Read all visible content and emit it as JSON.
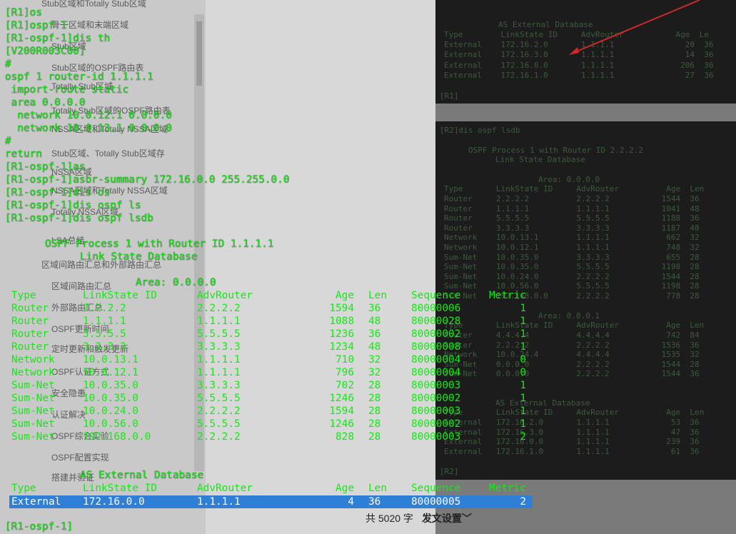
{
  "terminal": {
    "lines": [
      "[R1]os",
      "[R1]ospf 1",
      "[R1-ospf-1]dis th",
      "[V200R003C00]",
      "#",
      "ospf 1 router-id 1.1.1.1",
      " import-route static",
      " area 0.0.0.0",
      "  network 10.0.12.1 0.0.0.0",
      "  network 10.0.13.1 0.0.0.0",
      "#",
      "return",
      "[R1-ospf-1]as",
      "[R1-ospf-1]asbr-summary 172.16.0.0 255.255.0.0",
      "[R1-ospf-1]dis os",
      "[R1-ospf-1]dis ospf ls",
      "[R1-ospf-1]dis ospf lsdb"
    ],
    "process_title": "OSPF Process 1 with Router ID 1.1.1.1",
    "db_title": "Link State Database",
    "area_label": "Area: 0.0.0.0",
    "headers": [
      "Type",
      "LinkState ID",
      "AdvRouter",
      "Age",
      "Len",
      "Sequence",
      "Metric"
    ],
    "rows": [
      [
        "Router",
        "2.2.2.2",
        "2.2.2.2",
        "1594",
        "36",
        "80000006",
        "1"
      ],
      [
        "Router",
        "1.1.1.1",
        "1.1.1.1",
        "1088",
        "48",
        "80000028",
        "1"
      ],
      [
        "Router",
        "5.5.5.5",
        "5.5.5.5",
        "1236",
        "36",
        "80000002",
        "1"
      ],
      [
        "Router",
        "3.3.3.3",
        "3.3.3.3",
        "1234",
        "48",
        "80000008",
        "1"
      ],
      [
        "Network",
        "10.0.13.1",
        "1.1.1.1",
        "710",
        "32",
        "80000004",
        "0"
      ],
      [
        "Network",
        "10.0.12.1",
        "1.1.1.1",
        "796",
        "32",
        "80000004",
        "0"
      ],
      [
        "Sum-Net",
        "10.0.35.0",
        "3.3.3.3",
        "702",
        "28",
        "80000003",
        "1"
      ],
      [
        "Sum-Net",
        "10.0.35.0",
        "5.5.5.5",
        "1246",
        "28",
        "80000002",
        "1"
      ],
      [
        "Sum-Net",
        "10.0.24.0",
        "2.2.2.2",
        "1594",
        "28",
        "80000003",
        "1"
      ],
      [
        "Sum-Net",
        "10.0.56.0",
        "5.5.5.5",
        "1246",
        "28",
        "80000002",
        "1"
      ],
      [
        "Sum-Net",
        "192.168.0.0",
        "2.2.2.2",
        "828",
        "28",
        "80000003",
        "2"
      ]
    ],
    "ext_title": "AS External Database",
    "ext_row": [
      "External",
      "172.16.0.0",
      "1.1.1.1",
      "4",
      "36",
      "80000005",
      "2"
    ],
    "prompt": "[R1-ospf-1]"
  },
  "outline": {
    "items": [
      "Stub区域和Totally Stub区域",
      "骨干区域和末端区域",
      "Stub区域",
      "Stub区域的OSPF路由表",
      "Totally Stub区域",
      "Totally Stub区域的OSPF路由表",
      "NSSA区域和Totally NSSA区域",
      "Stub区域、Totally Stub区域存",
      "NSSA区域",
      "NSSA区域和Totally NSSA区域",
      "Totally NSSA区域",
      "LSA总结",
      "区域间路由汇总和外部路由汇总",
      "区域间路由汇总",
      "外部路由汇总",
      "OSPF更新时间",
      "定时更新和触发更新",
      "OSPF认证方式",
      "安全隐患",
      "认证解决",
      "OSPF综合实验",
      "OSPF配置实现",
      "搭建并验证"
    ]
  },
  "status_bar": {
    "word_count": "共 5020 字",
    "publish_settings": "发文设置"
  },
  "bg_terminal_r1": {
    "title": "AS External Database",
    "headers": "Type        LinkState ID     AdvRouter           Age  Le",
    "rows": [
      "External    172.16.2.0       1.1.1.1               20  36",
      "External    172.16.3.0       1.1.1.1               14  36",
      "External    172.16.0.0       1.1.1.1              206  36",
      "External    172.16.1.0       1.1.1.1               27  36"
    ],
    "prompt": "[R1]"
  },
  "bg_terminal_r2": {
    "command": "[R2]dis ospf lsdb",
    "process_title": "OSPF Process 1 with Router ID 2.2.2.2",
    "db_title": "Link State Database",
    "area0_label": "Area: 0.0.0.0",
    "headers": "Type       LinkState ID     AdvRouter          Age  Len",
    "area0_rows": [
      "Router     2.2.2.2          2.2.2.2           1544  36",
      "Router     1.1.1.1          1.1.1.1           1041  48",
      "Router     5.5.5.5          5.5.5.5           1188  36",
      "Router     3.3.3.3          3.3.3.3           1187  48",
      "Network    10.0.13.1        1.1.1.1            662  32",
      "Network    10.0.12.1        1.1.1.1            748  32",
      "Sum-Net    10.0.35.0        3.3.3.3            655  28",
      "Sum-Net    10.0.35.0        5.5.5.5           1198  28",
      "Sum-Net    10.0.24.0        2.2.2.2           1544  28",
      "Sum-Net    10.0.56.0        5.5.5.5           1198  28",
      "Sum-Net    192.168.0.0      2.2.2.2            778  28"
    ],
    "area1_label": "Area: 0.0.0.1",
    "area1_rows": [
      "Router     4.4.4.4          4.4.4.4            742  84",
      "Router     2.2.2.2          2.2.2.2           1536  36",
      "Network    10.0.24.4        4.4.4.4           1535  32",
      "Sum-Net    0.0.0.0          2.2.2.2           1544  28",
      "Sum-Net    0.0.0.0          2.2.2.2           1544  36"
    ],
    "ext_title": "AS External Database",
    "ext_rows": [
      "External   172.16.2.0       1.1.1.1             53  36",
      "External   172.16.3.0       1.1.1.1             47  36",
      "External   172.16.0.0       1.1.1.1            239  36",
      "External   172.16.1.0       1.1.1.1             61  36"
    ],
    "prompt": "[R2]"
  },
  "colors": {
    "terminal_green": "#19e619",
    "highlight_blue": "#2f7fd6",
    "arrow_red": "#cc2a2a"
  }
}
